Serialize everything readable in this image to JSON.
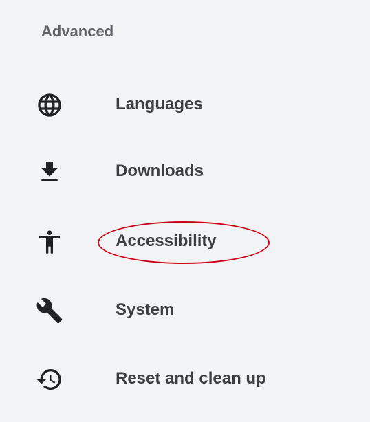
{
  "sidebar": {
    "section_title": "Advanced",
    "items": [
      {
        "label": "Languages",
        "icon": "globe-icon"
      },
      {
        "label": "Downloads",
        "icon": "download-icon"
      },
      {
        "label": "Accessibility",
        "icon": "accessibility-icon",
        "highlighted": true
      },
      {
        "label": "System",
        "icon": "wrench-icon"
      },
      {
        "label": "Reset and clean up",
        "icon": "restore-icon"
      }
    ]
  },
  "colors": {
    "background": "#f1f3f4",
    "text": "#3c4043",
    "header_text": "#5f6368",
    "icon": "#202124",
    "annotation": "#d0021b"
  }
}
